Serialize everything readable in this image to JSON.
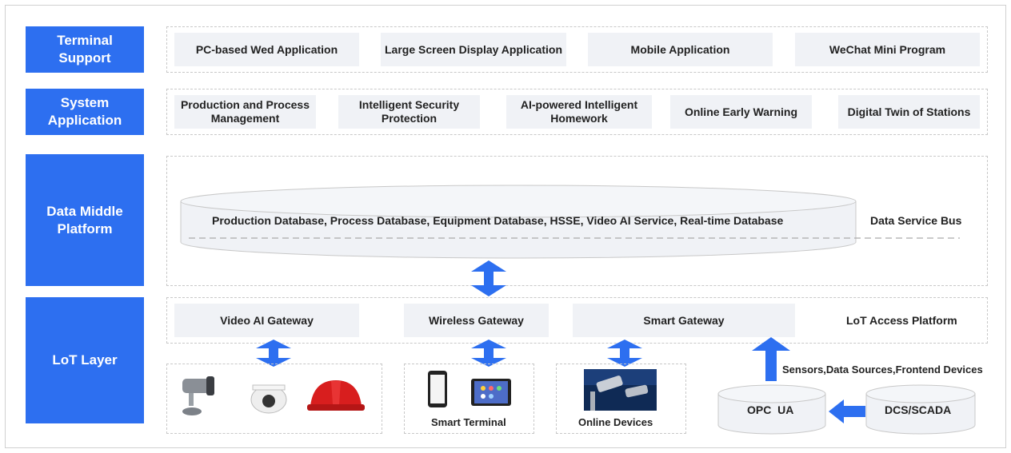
{
  "layers": {
    "terminal": "Terminal Support",
    "system": "System Application",
    "data": "Data Middle Platform",
    "iot": "LoT Layer"
  },
  "terminal_items": [
    "PC-based Wed Application",
    "Large Screen Display Application",
    "Mobile Application",
    "WeChat Mini Program"
  ],
  "system_items": [
    "Production and Process Management",
    "Intelligent Security Protection",
    "AI-powered Intelligent Homework",
    "Online Early Warning",
    "Digital Twin of Stations"
  ],
  "data_platform": {
    "databases": "Production Database, Process Database, Equipment Database, HSSE, Video AI Service, Real-time Database",
    "bus": "Data Service Bus"
  },
  "iot": {
    "gateways": [
      "Video AI Gateway",
      "Wireless Gateway",
      "Smart Gateway"
    ],
    "access_platform": "LoT Access Platform",
    "smart_terminal": "Smart Terminal",
    "online_devices": "Online Devices",
    "sensors": "Sensors,Data Sources,Frontend Devices",
    "opc": "OPC  UA",
    "dcs": "DCS/SCADA"
  },
  "colors": {
    "accent": "#2d6ff0",
    "cell_bg": "#f0f2f6"
  },
  "icons": [
    "bullet-camera-icon",
    "dome-camera-icon",
    "safety-helmet-icon",
    "smartphone-icon",
    "tablet-icon",
    "surveillance-camera-photo-icon"
  ]
}
